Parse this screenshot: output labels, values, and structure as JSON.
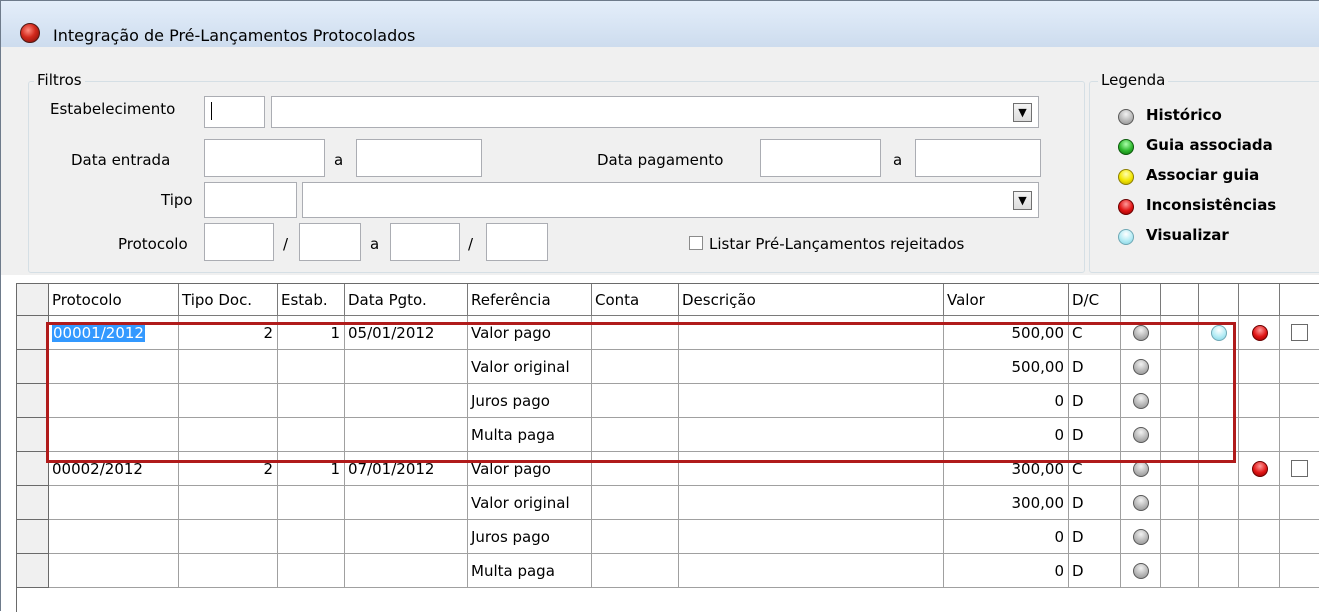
{
  "window": {
    "title": "Integração de Pré-Lançamentos Protocolados"
  },
  "filters": {
    "group_label": "Filtros",
    "estabelecimento_label": "Estabelecimento",
    "estabelecimento_code": "",
    "estabelecimento_name": "",
    "data_entrada_label": "Data entrada",
    "data_entrada_from": "",
    "range_sep": "a",
    "data_entrada_to": "",
    "data_pagamento_label": "Data pagamento",
    "data_pagamento_from": "",
    "data_pagamento_to": "",
    "tipo_label": "Tipo",
    "tipo_code": "",
    "tipo_name": "",
    "protocolo_label": "Protocolo",
    "slash": "/",
    "protocolo_from_num": "",
    "protocolo_from_year": "",
    "protocolo_to_num": "",
    "protocolo_to_year": "",
    "rejected_checkbox_label": "Listar Pré-Lançamentos rejeitados",
    "rejected_checked": false
  },
  "legend": {
    "group_label": "Legenda",
    "items": [
      {
        "label": "Histórico",
        "color": "gray"
      },
      {
        "label": "Guia associada",
        "color": "green"
      },
      {
        "label": "Associar guia",
        "color": "yellow"
      },
      {
        "label": "Inconsistências",
        "color": "red"
      },
      {
        "label": "Visualizar",
        "color": "cyan"
      }
    ]
  },
  "grid": {
    "columns": [
      "Protocolo",
      "Tipo Doc.",
      "Estab.",
      "Data Pgto.",
      "Referência",
      "Conta",
      "Descrição",
      "Valor",
      "D/C",
      "",
      "",
      "",
      "",
      ""
    ],
    "rows": [
      {
        "protocolo": "00001/2012",
        "tipo_doc": "2",
        "estab": "1",
        "data_pgto": "05/01/2012",
        "referencia": "Valor pago",
        "conta": "",
        "descricao": "",
        "valor": "500,00",
        "dc": "C",
        "icons": [
          "gray",
          "",
          "cyan",
          "red"
        ],
        "check": true,
        "selected": true
      },
      {
        "protocolo": "",
        "tipo_doc": "",
        "estab": "",
        "data_pgto": "",
        "referencia": "Valor original",
        "conta": "",
        "descricao": "",
        "valor": "500,00",
        "dc": "D",
        "icons": [
          "gray",
          "",
          "",
          ""
        ],
        "check": false
      },
      {
        "protocolo": "",
        "tipo_doc": "",
        "estab": "",
        "data_pgto": "",
        "referencia": "Juros pago",
        "conta": "",
        "descricao": "",
        "valor": "0",
        "dc": "D",
        "icons": [
          "gray",
          "",
          "",
          ""
        ],
        "check": false
      },
      {
        "protocolo": "",
        "tipo_doc": "",
        "estab": "",
        "data_pgto": "",
        "referencia": "Multa paga",
        "conta": "",
        "descricao": "",
        "valor": "0",
        "dc": "D",
        "icons": [
          "gray",
          "",
          "",
          ""
        ],
        "check": false
      },
      {
        "protocolo": "00002/2012",
        "tipo_doc": "2",
        "estab": "1",
        "data_pgto": "07/01/2012",
        "referencia": "Valor pago",
        "conta": "",
        "descricao": "",
        "valor": "300,00",
        "dc": "C",
        "icons": [
          "gray",
          "",
          "",
          "red"
        ],
        "check": true
      },
      {
        "protocolo": "",
        "tipo_doc": "",
        "estab": "",
        "data_pgto": "",
        "referencia": "Valor original",
        "conta": "",
        "descricao": "",
        "valor": "300,00",
        "dc": "D",
        "icons": [
          "gray",
          "",
          "",
          ""
        ],
        "check": false
      },
      {
        "protocolo": "",
        "tipo_doc": "",
        "estab": "",
        "data_pgto": "",
        "referencia": "Juros pago",
        "conta": "",
        "descricao": "",
        "valor": "0",
        "dc": "D",
        "icons": [
          "gray",
          "",
          "",
          ""
        ],
        "check": false
      },
      {
        "protocolo": "",
        "tipo_doc": "",
        "estab": "",
        "data_pgto": "",
        "referencia": "Multa paga",
        "conta": "",
        "descricao": "",
        "valor": "0",
        "dc": "D",
        "icons": [
          "gray",
          "",
          "",
          ""
        ],
        "check": false
      }
    ]
  },
  "colors": {
    "highlight": "#b01b1b",
    "selection": "#3399ff"
  }
}
